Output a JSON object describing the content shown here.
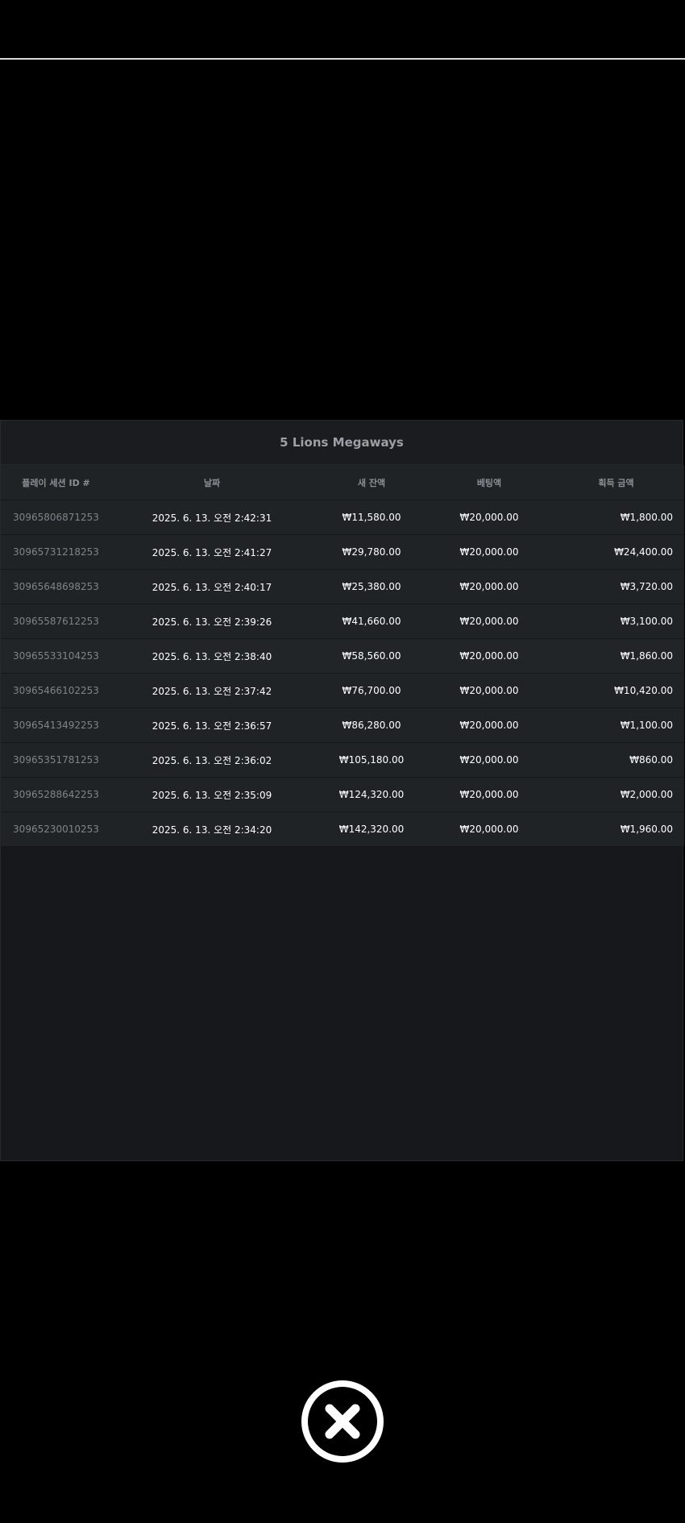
{
  "panel": {
    "title": "5 Lions Megaways"
  },
  "table": {
    "headers": {
      "session_id": "플레이 세션 ID #",
      "date": "날짜",
      "balance": "새 잔액",
      "bet": "베팅액",
      "win": "획득 금액"
    },
    "rows": [
      {
        "id": "30965806871253",
        "date": "2025. 6. 13. 오전 2:42:31",
        "balance": "₩11,580.00",
        "bet": "₩20,000.00",
        "win": "₩1,800.00"
      },
      {
        "id": "30965731218253",
        "date": "2025. 6. 13. 오전 2:41:27",
        "balance": "₩29,780.00",
        "bet": "₩20,000.00",
        "win": "₩24,400.00"
      },
      {
        "id": "30965648698253",
        "date": "2025. 6. 13. 오전 2:40:17",
        "balance": "₩25,380.00",
        "bet": "₩20,000.00",
        "win": "₩3,720.00"
      },
      {
        "id": "30965587612253",
        "date": "2025. 6. 13. 오전 2:39:26",
        "balance": "₩41,660.00",
        "bet": "₩20,000.00",
        "win": "₩3,100.00"
      },
      {
        "id": "30965533104253",
        "date": "2025. 6. 13. 오전 2:38:40",
        "balance": "₩58,560.00",
        "bet": "₩20,000.00",
        "win": "₩1,860.00"
      },
      {
        "id": "30965466102253",
        "date": "2025. 6. 13. 오전 2:37:42",
        "balance": "₩76,700.00",
        "bet": "₩20,000.00",
        "win": "₩10,420.00"
      },
      {
        "id": "30965413492253",
        "date": "2025. 6. 13. 오전 2:36:57",
        "balance": "₩86,280.00",
        "bet": "₩20,000.00",
        "win": "₩1,100.00"
      },
      {
        "id": "30965351781253",
        "date": "2025. 6. 13. 오전 2:36:02",
        "balance": "₩105,180.00",
        "bet": "₩20,000.00",
        "win": "₩860.00"
      },
      {
        "id": "30965288642253",
        "date": "2025. 6. 13. 오전 2:35:09",
        "balance": "₩124,320.00",
        "bet": "₩20,000.00",
        "win": "₩2,000.00"
      },
      {
        "id": "30965230010253",
        "date": "2025. 6. 13. 오전 2:34:20",
        "balance": "₩142,320.00",
        "bet": "₩20,000.00",
        "win": "₩1,960.00"
      }
    ]
  },
  "close_button": {
    "icon": "close-icon"
  },
  "colors": {
    "background": "#000000",
    "panel": "#16181b",
    "row": "#1f2326",
    "header_text": "#8b9096",
    "id_text": "#7e848a",
    "cell_text": "#ffffff",
    "close_ring": "#ffffff"
  }
}
